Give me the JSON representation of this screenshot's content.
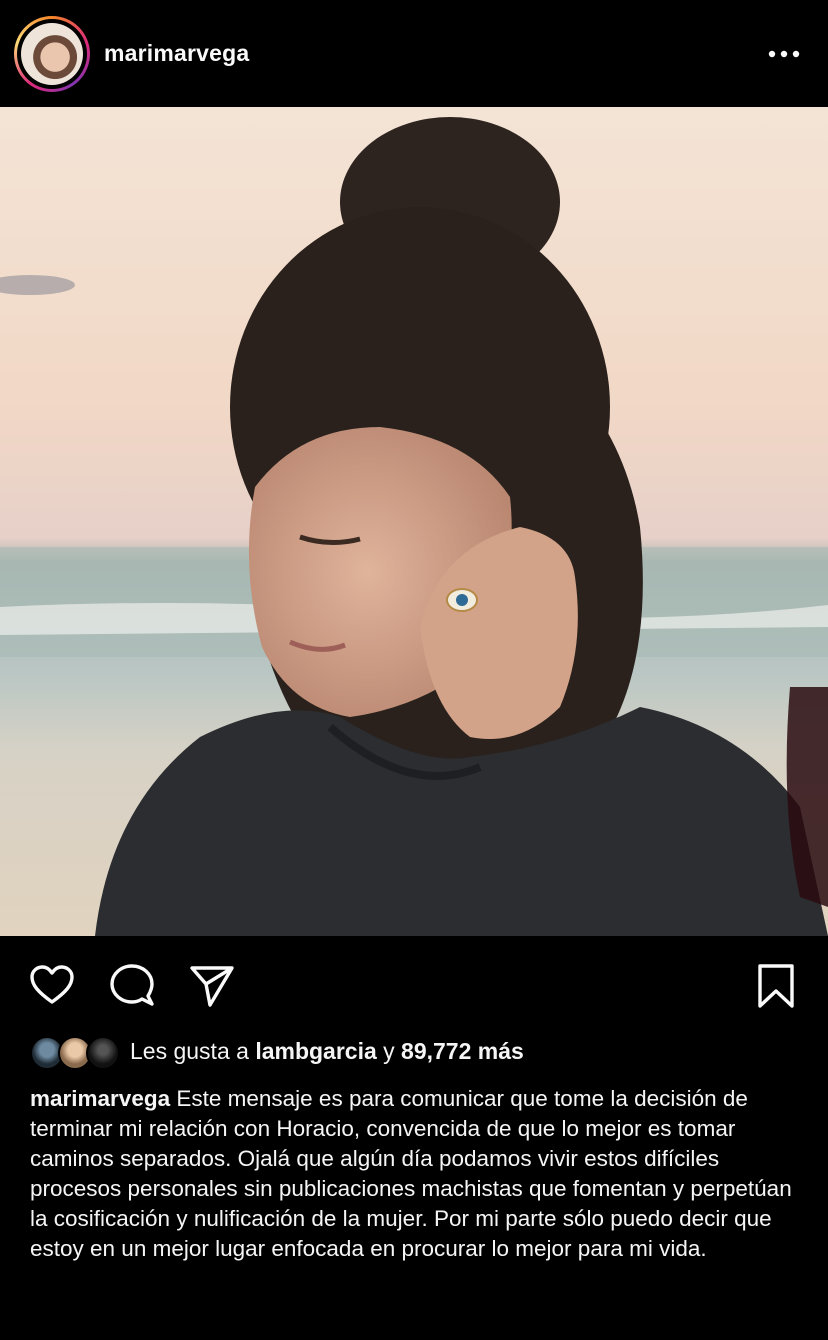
{
  "post": {
    "username": "marimarvega",
    "more_icon": "more-horizontal-icon"
  },
  "actions": {
    "like_icon": "heart-icon",
    "comment_icon": "comment-icon",
    "share_icon": "send-icon",
    "save_icon": "bookmark-icon"
  },
  "likes": {
    "prefix": "Les gusta a",
    "user": "lambgarcia",
    "connector": "y",
    "count": "89,772 más"
  },
  "caption": {
    "username": "marimarvega",
    "text": "Este mensaje es para comunicar que tome la decisión de terminar mi relación con Horacio, convencida de que lo mejor  es tomar caminos separados. Ojalá que algún día podamos vivir estos difíciles procesos personales sin publicaciones machistas que fomentan y perpetúan la cosificación y nulificación de la mujer. Por mi parte sólo puedo decir que estoy en un mejor lugar enfocada en procurar lo mejor para mi vida."
  },
  "colors": {
    "background": "#000000",
    "text": "#f5f5f5",
    "story_ring": "#dd2a7b"
  }
}
